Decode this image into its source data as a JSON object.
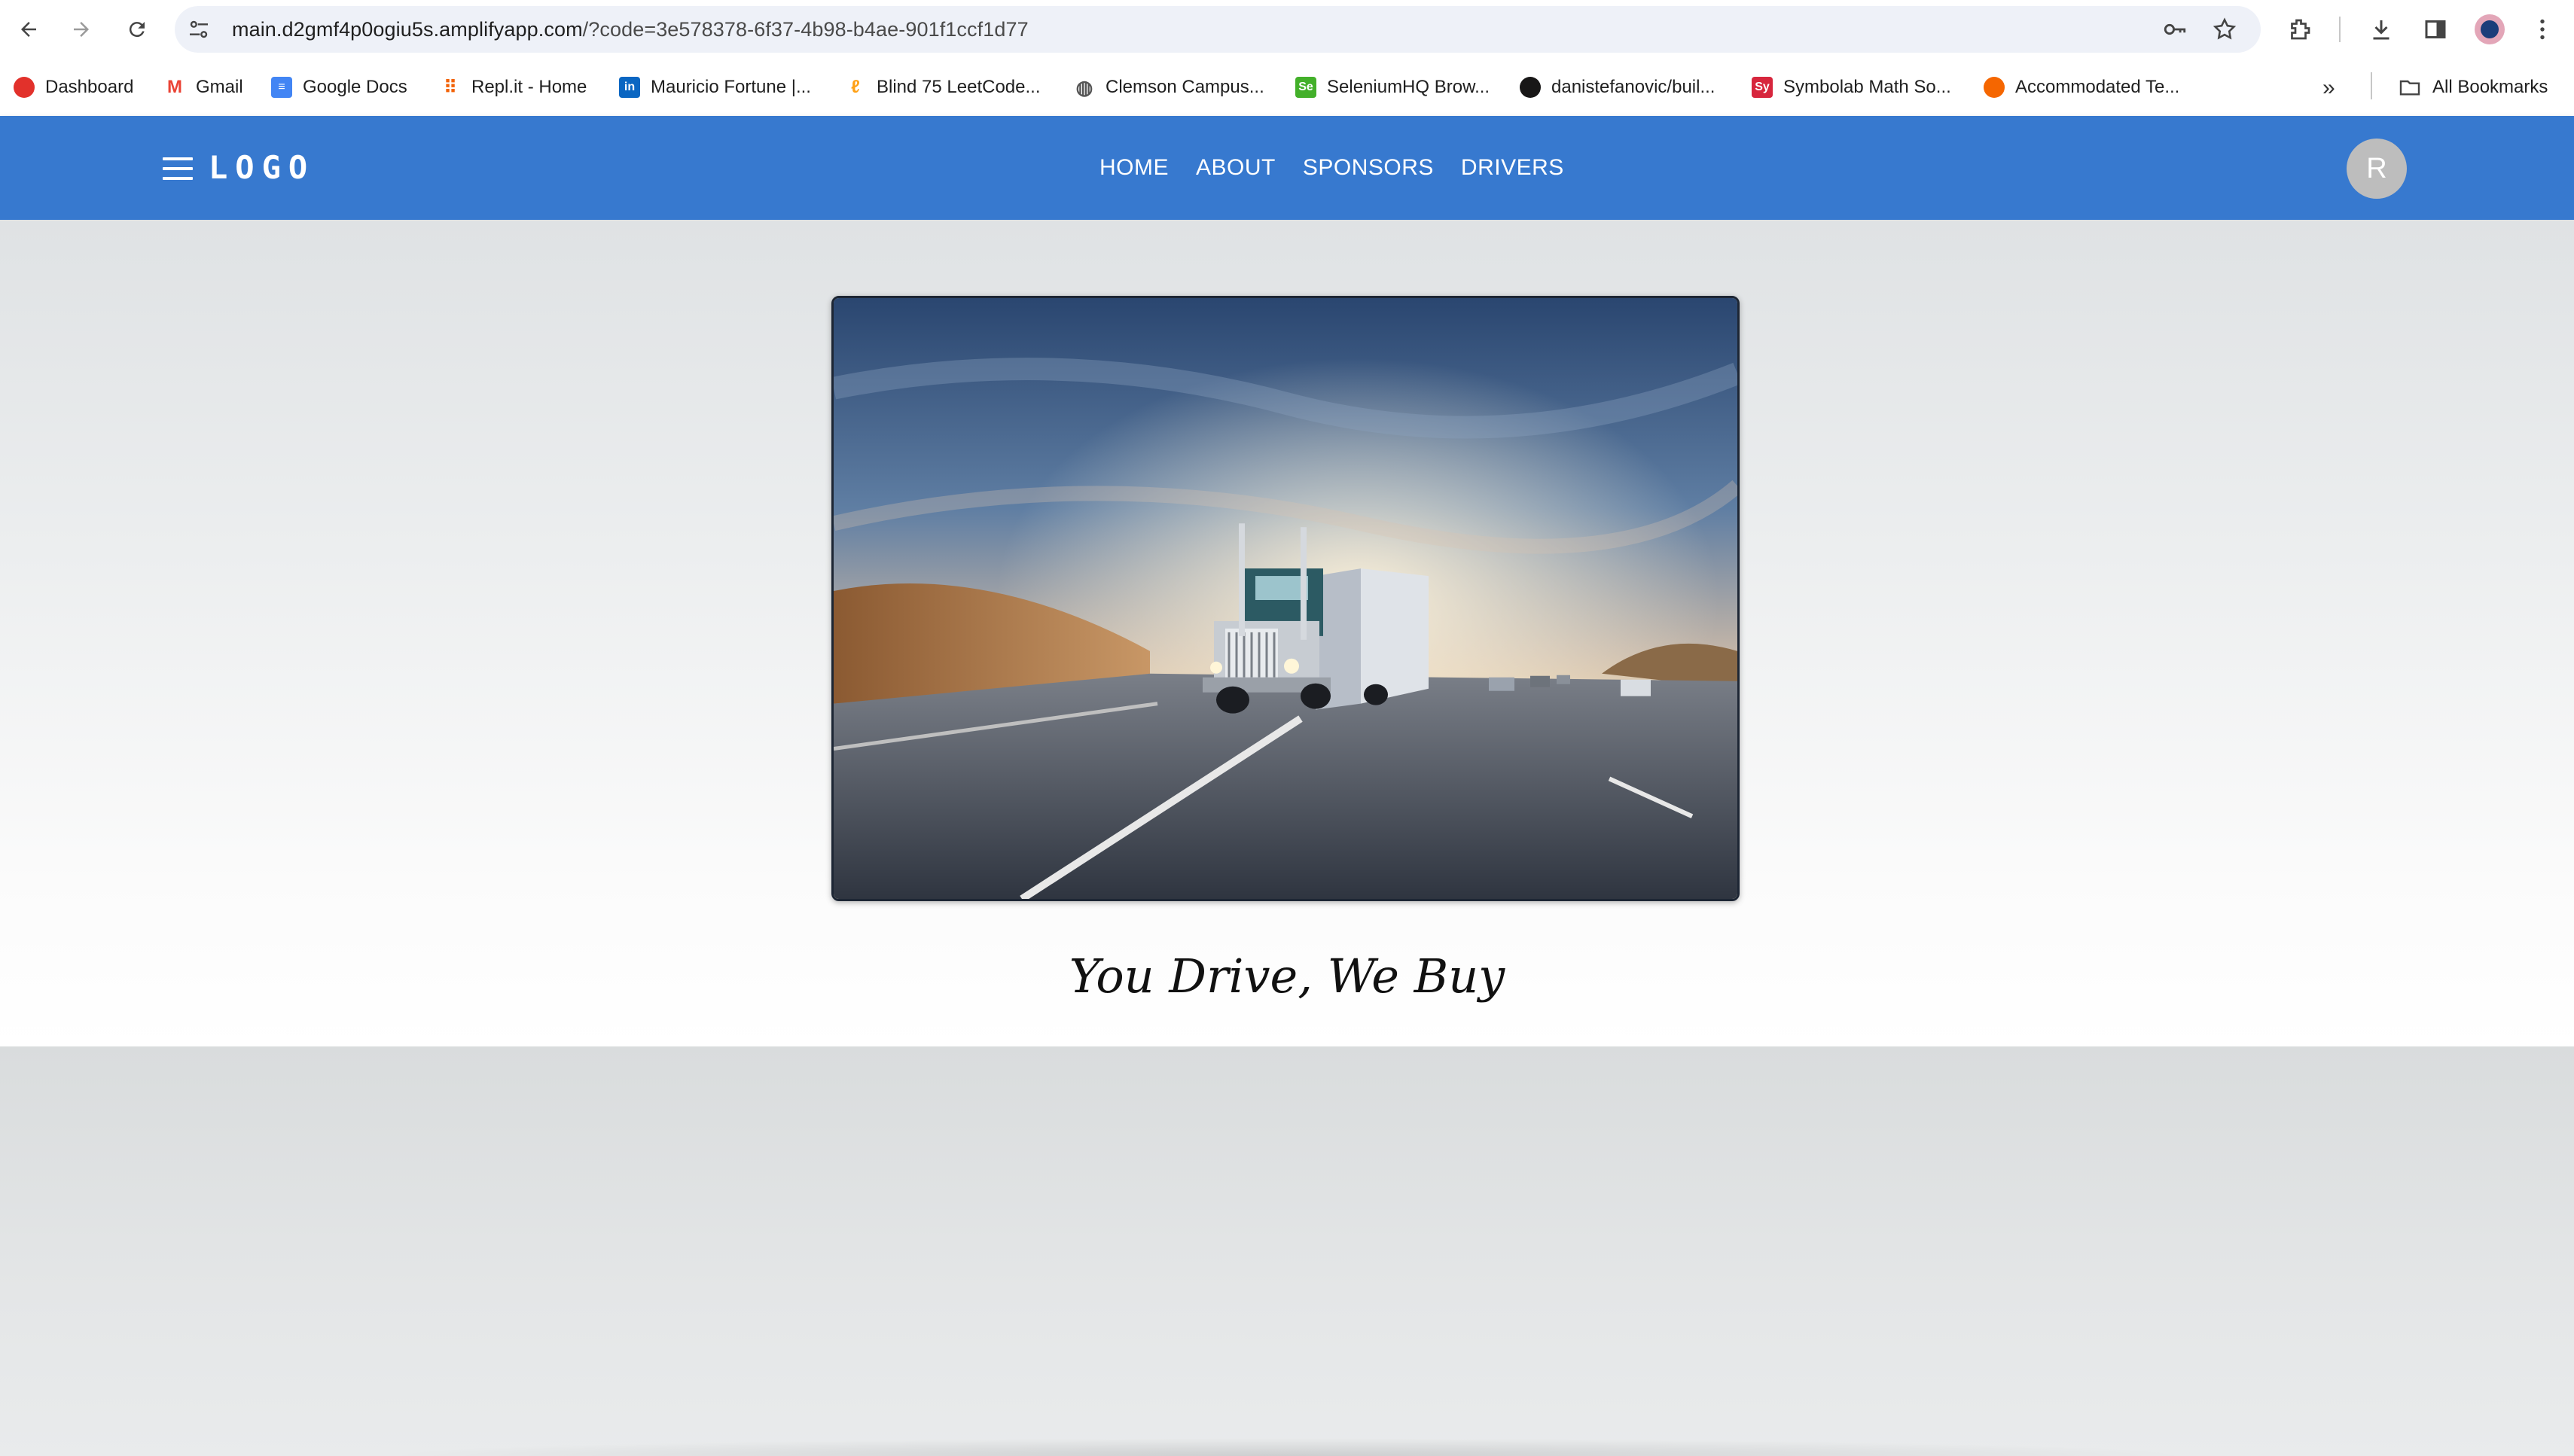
{
  "browser": {
    "url_host": "main.d2gmf4p0ogiu5s.amplifyapp.com",
    "url_path": "/?code=3e578378-6f37-4b98-b4ae-901f1ccf1d77",
    "icons": [
      "back-arrow-icon",
      "forward-arrow-icon",
      "reload-icon",
      "site-info-icon",
      "password-key-icon",
      "bookmark-star-icon",
      "extensions-icon",
      "downloads-icon",
      "side-panel-icon",
      "profile-icon",
      "more-menu-icon"
    ]
  },
  "bookmarks": {
    "items": [
      {
        "label": "Dashboard",
        "icon": "canvas-icon",
        "color": "#e2312b"
      },
      {
        "label": "Gmail",
        "icon": "gmail-icon",
        "color": "#ea4335"
      },
      {
        "label": "Google Docs",
        "icon": "docs-icon",
        "color": "#4285f4"
      },
      {
        "label": "Repl.it - Home",
        "icon": "replit-icon",
        "color": "#f26207"
      },
      {
        "label": "Mauricio Fortune |...",
        "icon": "linkedin-icon",
        "color": "#0a66c2"
      },
      {
        "label": "Blind 75 LeetCode...",
        "icon": "leetcode-icon",
        "color": "#ffa116"
      },
      {
        "label": "Clemson Campus...",
        "icon": "globe-icon",
        "color": "#555555"
      },
      {
        "label": "SeleniumHQ Brow...",
        "icon": "selenium-icon",
        "color": "#43b02a"
      },
      {
        "label": "danistefanovic/buil...",
        "icon": "github-icon",
        "color": "#181717"
      },
      {
        "label": "Symbolab Math So...",
        "icon": "symbolab-icon",
        "color": "#d7263d"
      },
      {
        "label": "Accommodated Te...",
        "icon": "clemson-paw-icon",
        "color": "#f56600"
      }
    ],
    "all_bookmarks_label": "All Bookmarks"
  },
  "app": {
    "logo": "LOGO",
    "nav": [
      "HOME",
      "ABOUT",
      "SPONSORS",
      "DRIVERS"
    ],
    "avatar_initial": "R",
    "brand_color": "#3779cf"
  },
  "hero": {
    "image_alt": "semi-truck-on-highway-at-sunset",
    "tagline": "You Drive, We Buy"
  }
}
